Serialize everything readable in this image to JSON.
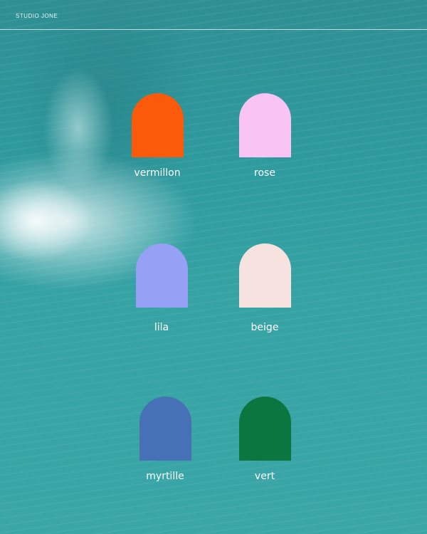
{
  "brand": "STUDIO JONE",
  "swatches": [
    {
      "label": "vermillon",
      "color": "#fa5a0a"
    },
    {
      "label": "rose",
      "color": "#f9c3f4"
    },
    {
      "label": "lila",
      "color": "#96a0f4"
    },
    {
      "label": "beige",
      "color": "#f6e3df"
    },
    {
      "label": "myrtille",
      "color": "#4771b6"
    },
    {
      "label": "vert",
      "color": "#0c7641"
    }
  ]
}
